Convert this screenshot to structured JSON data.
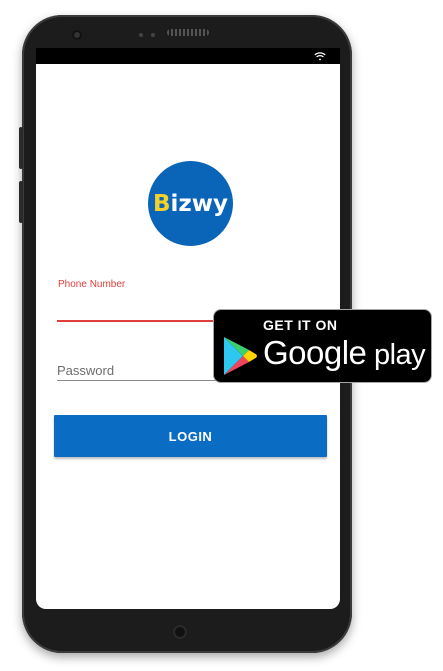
{
  "app": {
    "logo_text_first": "B",
    "logo_text_rest": "izwy",
    "brand_color": "#0a64b8",
    "logo_accent_color": "#f4d02a"
  },
  "form": {
    "phone_label": "Phone Number",
    "phone_value": "",
    "password_placeholder": "Password",
    "password_value": "",
    "login_label": "LOGIN",
    "error_color": "#e0403c"
  },
  "status_bar": {
    "icons": [
      "wifi-icon"
    ]
  },
  "store_badge": {
    "top_text": "GET IT ON",
    "brand_text": "Google",
    "play_text": " play",
    "icon": "google-play-icon"
  }
}
